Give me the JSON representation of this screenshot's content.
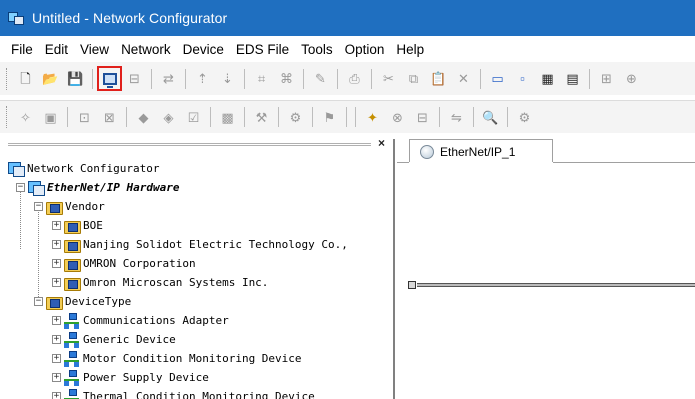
{
  "window": {
    "title": "Untitled - Network Configurator"
  },
  "menu": [
    "File",
    "Edit",
    "View",
    "Network",
    "Device",
    "EDS File",
    "Tools",
    "Option",
    "Help"
  ],
  "panel": {
    "close_glyph": "×"
  },
  "tree": {
    "root": "Network Configurator",
    "hardware": "EtherNet/IP Hardware",
    "vendor_folder": "Vendor",
    "vendors": [
      "BOE",
      "Nanjing Solidot Electric Technology Co.,",
      "OMRON Corporation",
      "Omron Microscan Systems Inc."
    ],
    "devicetype_folder": "DeviceType",
    "devicetypes": [
      "Communications Adapter",
      "Generic Device",
      "Motor Condition Monitoring Device",
      "Power Supply Device",
      "Thermal Condition Monitoring Device"
    ]
  },
  "tabs": [
    {
      "label": "EtherNet/IP_1",
      "active": true
    }
  ],
  "colors": {
    "titlebar": "#1f6fc0",
    "highlight_outline": "#e0201b"
  }
}
